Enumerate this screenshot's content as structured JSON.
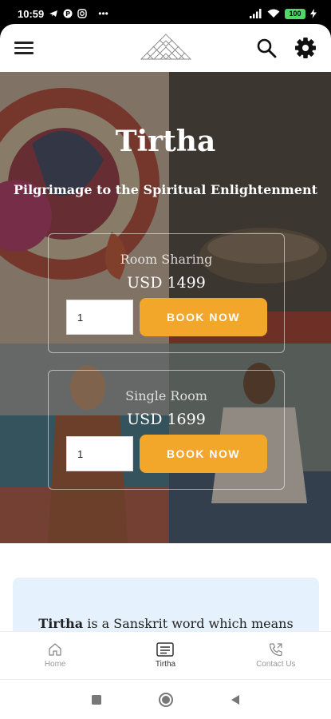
{
  "status_bar": {
    "time": "10:59",
    "dots": "•••",
    "battery": "100"
  },
  "app_bar": {
    "icons": [
      "menu-icon",
      "logo",
      "search-icon",
      "gear-icon"
    ]
  },
  "hero": {
    "title": "Tirtha",
    "subtitle": "Pilgrimage to the Spiritual Enlightenment"
  },
  "rooms": [
    {
      "type": "Room Sharing",
      "price": "USD 1499",
      "quantity": "1",
      "button": "BOOK NOW"
    },
    {
      "type": "Single Room",
      "price": "USD 1699",
      "quantity": "1",
      "button": "BOOK NOW"
    }
  ],
  "info": {
    "term": "Tirtha",
    "text": " is a Sanskrit word which means"
  },
  "bottom_nav": {
    "items": [
      {
        "label": "Home",
        "icon": "home-icon",
        "active": false
      },
      {
        "label": "Tirtha",
        "icon": "tirtha-icon",
        "active": true
      },
      {
        "label": "Contact Us",
        "icon": "phone-icon",
        "active": false
      }
    ]
  },
  "colors": {
    "accent": "#f2a62a",
    "info_bg": "#e5f1fc"
  }
}
